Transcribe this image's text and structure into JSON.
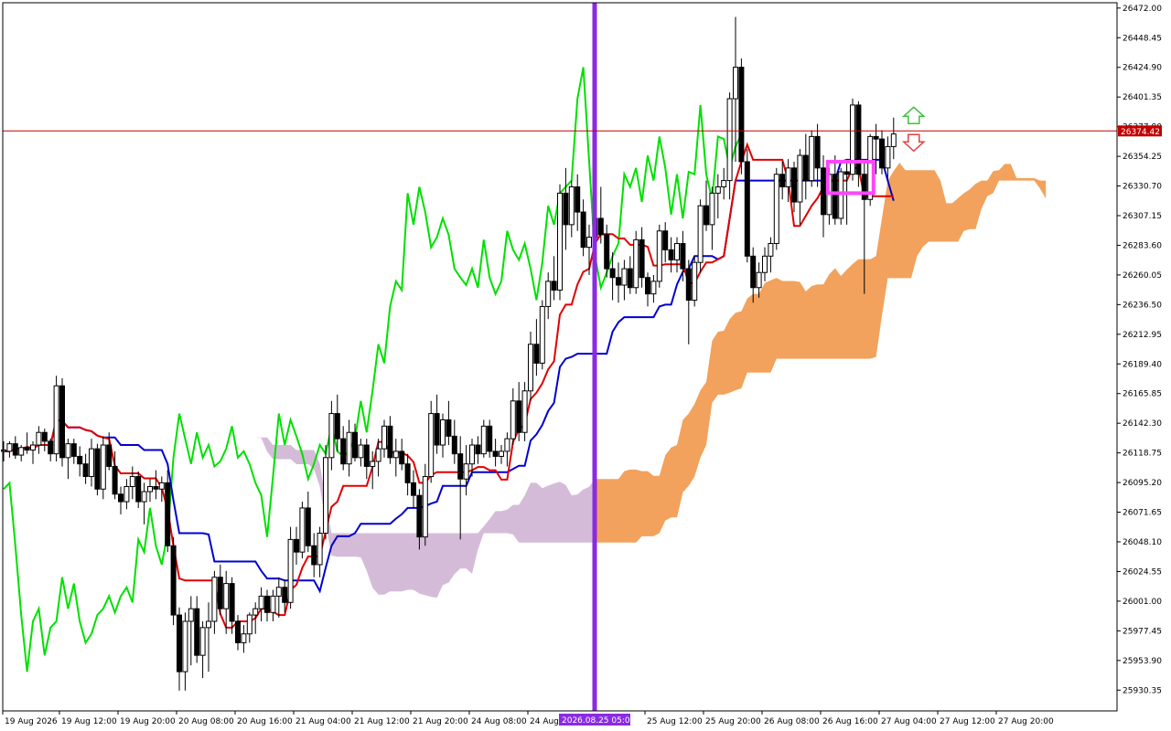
{
  "chart_data": {
    "type": "candlestick",
    "symbol_price_current": 26374.42,
    "current_price_label": "26374.42",
    "y_ticks": [
      "26472.00",
      "26448.45",
      "26424.90",
      "26401.35",
      "26377.80",
      "26354.25",
      "26330.70",
      "26307.15",
      "26283.60",
      "26260.05",
      "26236.50",
      "26212.95",
      "26189.40",
      "26165.85",
      "26142.30",
      "26118.75",
      "26095.20",
      "26071.65",
      "26048.10",
      "26024.55",
      "26001.00",
      "25977.45",
      "25953.90",
      "25930.35"
    ],
    "ylim": [
      25913.86,
      26476.22
    ],
    "x_ticks": [
      "19 Aug 2026",
      "19 Aug 12:00",
      "19 Aug 20:00",
      "20 Aug 08:00",
      "20 Aug 16:00",
      "21 Aug 04:00",
      "21 Aug 12:00",
      "21 Aug 20:00",
      "24 Aug 08:00",
      "24 Aug",
      "25 Aug 12:00",
      "25 Aug 20:00",
      "26 Aug 08:00",
      "26 Aug 16:00",
      "27 Aug 04:00",
      "27 Aug 12:00",
      "27 Aug 20:00"
    ],
    "vline_label": "2026.08.25 05:00",
    "colors": {
      "background": "#ffffff",
      "grid_axis": "#000000",
      "tenkan": "#e00000",
      "kijun": "#0000d0",
      "chikou": "#00e000",
      "cloud_past": "#d4bcd8",
      "cloud_future": "#f2a25c",
      "vline": "#8a2be2",
      "price_line": "#c00000",
      "price_label_bg": "#c00000",
      "highlight_box": "#ff44ff",
      "arrow_up": "#40c040",
      "arrow_down": "#e04040"
    },
    "series": [
      {
        "name": "candles",
        "ohlc": [
          [
            26120,
            26128,
            26112,
            26121
          ],
          [
            26120,
            26128,
            26115,
            26126
          ],
          [
            26126,
            26132,
            26114,
            26117
          ],
          [
            26117,
            26125,
            26112,
            26123
          ],
          [
            26123,
            26135,
            26118,
            26121
          ],
          [
            26121,
            26128,
            26110,
            26125
          ],
          [
            26125,
            26140,
            26118,
            26135
          ],
          [
            26135,
            26138,
            26120,
            26128
          ],
          [
            26128,
            26130,
            26112,
            26118
          ],
          [
            26118,
            26180,
            26112,
            26172
          ],
          [
            26172,
            26178,
            26108,
            26115
          ],
          [
            26115,
            26130,
            26098,
            26126
          ],
          [
            26126,
            26130,
            26110,
            26116
          ],
          [
            26116,
            26124,
            26100,
            26110
          ],
          [
            26110,
            26118,
            26094,
            26100
          ],
          [
            26100,
            26130,
            26092,
            26122
          ],
          [
            26122,
            26126,
            26085,
            26090
          ],
          [
            26090,
            26132,
            26082,
            26125
          ],
          [
            26125,
            26135,
            26105,
            26108
          ],
          [
            26108,
            26120,
            26082,
            26086
          ],
          [
            26086,
            26092,
            26070,
            26080
          ],
          [
            26080,
            26098,
            26074,
            26092
          ],
          [
            26092,
            26108,
            26082,
            26100
          ],
          [
            26100,
            26104,
            26075,
            26080
          ],
          [
            26080,
            26095,
            26062,
            26088
          ],
          [
            26088,
            26098,
            26080,
            26092
          ],
          [
            26092,
            26105,
            26082,
            26090
          ],
          [
            26090,
            26100,
            26080,
            26095
          ],
          [
            26095,
            26105,
            26040,
            26045
          ],
          [
            26045,
            26052,
            25982,
            25990
          ],
          [
            25990,
            25996,
            25930,
            25945
          ],
          [
            25945,
            25992,
            25930,
            25985
          ],
          [
            25985,
            26005,
            25950,
            25995
          ],
          [
            25995,
            26005,
            25952,
            25958
          ],
          [
            25958,
            25985,
            25940,
            25980
          ],
          [
            25980,
            26000,
            25945,
            25985
          ],
          [
            25985,
            26025,
            25975,
            26020
          ],
          [
            26020,
            26030,
            25990,
            25995
          ],
          [
            25995,
            26025,
            25975,
            26015
          ],
          [
            26015,
            26020,
            25975,
            25985
          ],
          [
            25985,
            25990,
            25962,
            25968
          ],
          [
            25968,
            25982,
            25960,
            25975
          ],
          [
            25975,
            25992,
            25968,
            25990
          ],
          [
            25990,
            26000,
            25975,
            25995
          ],
          [
            25995,
            26012,
            25985,
            26005
          ],
          [
            26005,
            26010,
            25985,
            25992
          ],
          [
            25992,
            26010,
            25985,
            26005
          ],
          [
            26005,
            26020,
            25988,
            26012
          ],
          [
            26012,
            26018,
            25992,
            26000
          ],
          [
            26000,
            26060,
            25995,
            26050
          ],
          [
            26050,
            26060,
            26030,
            26040
          ],
          [
            26040,
            26080,
            26035,
            26075
          ],
          [
            26075,
            26088,
            26040,
            26045
          ],
          [
            26045,
            26055,
            26020,
            26030
          ],
          [
            26030,
            26060,
            26020,
            26055
          ],
          [
            26055,
            26125,
            26050,
            26115
          ],
          [
            26115,
            26160,
            26105,
            26150
          ],
          [
            26150,
            26165,
            26120,
            26130
          ],
          [
            26130,
            26140,
            26105,
            26110
          ],
          [
            26110,
            26145,
            26100,
            26135
          ],
          [
            26135,
            26142,
            26112,
            26115
          ],
          [
            26115,
            26130,
            26108,
            26125
          ],
          [
            26125,
            26130,
            26098,
            26108
          ],
          [
            26108,
            26120,
            26090,
            26112
          ],
          [
            26112,
            26130,
            26100,
            26122
          ],
          [
            26122,
            26145,
            26115,
            26140
          ],
          [
            26140,
            26148,
            26110,
            26115
          ],
          [
            26115,
            26130,
            26100,
            26120
          ],
          [
            26120,
            26130,
            26105,
            26110
          ],
          [
            26110,
            26118,
            26085,
            26095
          ],
          [
            26095,
            26105,
            26075,
            26085
          ],
          [
            26085,
            26090,
            26042,
            26052
          ],
          [
            26052,
            26110,
            26045,
            26100
          ],
          [
            26100,
            26160,
            26095,
            26150
          ],
          [
            26150,
            26165,
            26118,
            26125
          ],
          [
            26125,
            26150,
            26115,
            26145
          ],
          [
            26145,
            26160,
            26125,
            26132
          ],
          [
            26132,
            26145,
            26110,
            26118
          ],
          [
            26118,
            26132,
            26050,
            26098
          ],
          [
            26098,
            26125,
            26085,
            26110
          ],
          [
            26110,
            26130,
            26100,
            26125
          ],
          [
            26125,
            26132,
            26110,
            26118
          ],
          [
            26118,
            26145,
            26115,
            26140
          ],
          [
            26140,
            26145,
            26115,
            26120
          ],
          [
            26120,
            26130,
            26108,
            26116
          ],
          [
            26116,
            26125,
            26110,
            26120
          ],
          [
            26120,
            26135,
            26108,
            26130
          ],
          [
            26130,
            26170,
            26125,
            26160
          ],
          [
            26160,
            26175,
            26128,
            26135
          ],
          [
            26135,
            26175,
            26128,
            26168
          ],
          [
            26168,
            26215,
            26160,
            26205
          ],
          [
            26205,
            26225,
            26180,
            26190
          ],
          [
            26190,
            26240,
            26185,
            26235
          ],
          [
            26235,
            26262,
            26225,
            26255
          ],
          [
            26255,
            26275,
            26240,
            26248
          ],
          [
            26248,
            26332,
            26240,
            26325
          ],
          [
            26325,
            26345,
            26280,
            26300
          ],
          [
            26300,
            26335,
            26290,
            26330
          ],
          [
            26330,
            26340,
            26295,
            26310
          ],
          [
            26310,
            26320,
            26275,
            26282
          ],
          [
            26282,
            26300,
            26260,
            26290
          ],
          [
            26290,
            26315,
            26265,
            26305
          ],
          [
            26305,
            26330,
            26285,
            26292
          ],
          [
            26292,
            26300,
            26258,
            26265
          ],
          [
            26265,
            26278,
            26240,
            26258
          ],
          [
            26258,
            26270,
            26238,
            26252
          ],
          [
            26252,
            26272,
            26240,
            26265
          ],
          [
            26265,
            26275,
            26245,
            26250
          ],
          [
            26250,
            26295,
            26245,
            26288
          ],
          [
            26288,
            26298,
            26250,
            26258
          ],
          [
            26258,
            26262,
            26235,
            26245
          ],
          [
            26245,
            26260,
            26238,
            26255
          ],
          [
            26255,
            26300,
            26250,
            26295
          ],
          [
            26295,
            26302,
            26270,
            26280
          ],
          [
            26280,
            26290,
            26262,
            26272
          ],
          [
            26272,
            26290,
            26262,
            26285
          ],
          [
            26285,
            26295,
            26255,
            26265
          ],
          [
            26265,
            26272,
            26205,
            26240
          ],
          [
            26240,
            26275,
            26235,
            26270
          ],
          [
            26270,
            26320,
            26262,
            26315
          ],
          [
            26315,
            26335,
            26295,
            26300
          ],
          [
            26300,
            26330,
            26280,
            26325
          ],
          [
            26325,
            26340,
            26305,
            26330
          ],
          [
            26330,
            26345,
            26320,
            26335
          ],
          [
            26335,
            26405,
            26320,
            26400
          ],
          [
            26400,
            26465,
            26350,
            26425
          ],
          [
            26425,
            26432,
            26340,
            26350
          ],
          [
            26350,
            26360,
            26270,
            26275
          ],
          [
            26275,
            26282,
            26238,
            26250
          ],
          [
            26250,
            26270,
            26242,
            26262
          ],
          [
            26262,
            26282,
            26255,
            26275
          ],
          [
            26275,
            26290,
            26262,
            26285
          ],
          [
            26285,
            26345,
            26280,
            26340
          ],
          [
            26340,
            26350,
            26320,
            26330
          ],
          [
            26330,
            26352,
            26318,
            26345
          ],
          [
            26345,
            26350,
            26310,
            26318
          ],
          [
            26318,
            26360,
            26300,
            26355
          ],
          [
            26355,
            26372,
            26320,
            26335
          ],
          [
            26335,
            26375,
            26330,
            26370
          ],
          [
            26370,
            26380,
            26330,
            26345
          ],
          [
            26345,
            26355,
            26290,
            26308
          ],
          [
            26308,
            26345,
            26300,
            26340
          ],
          [
            26340,
            26355,
            26300,
            26305
          ],
          [
            26305,
            26345,
            26300,
            26342
          ],
          [
            26342,
            26352,
            26300,
            26340
          ],
          [
            26340,
            26400,
            26335,
            26395
          ],
          [
            26395,
            26398,
            26330,
            26340
          ],
          [
            26340,
            26352,
            26245,
            26320
          ],
          [
            26320,
            26372,
            26315,
            26370
          ],
          [
            26370,
            26380,
            26340,
            26368
          ],
          [
            26368,
            26375,
            26340,
            26345
          ],
          [
            26345,
            26370,
            26335,
            26362
          ],
          [
            26362,
            26385,
            26352,
            26372
          ]
        ]
      }
    ]
  }
}
